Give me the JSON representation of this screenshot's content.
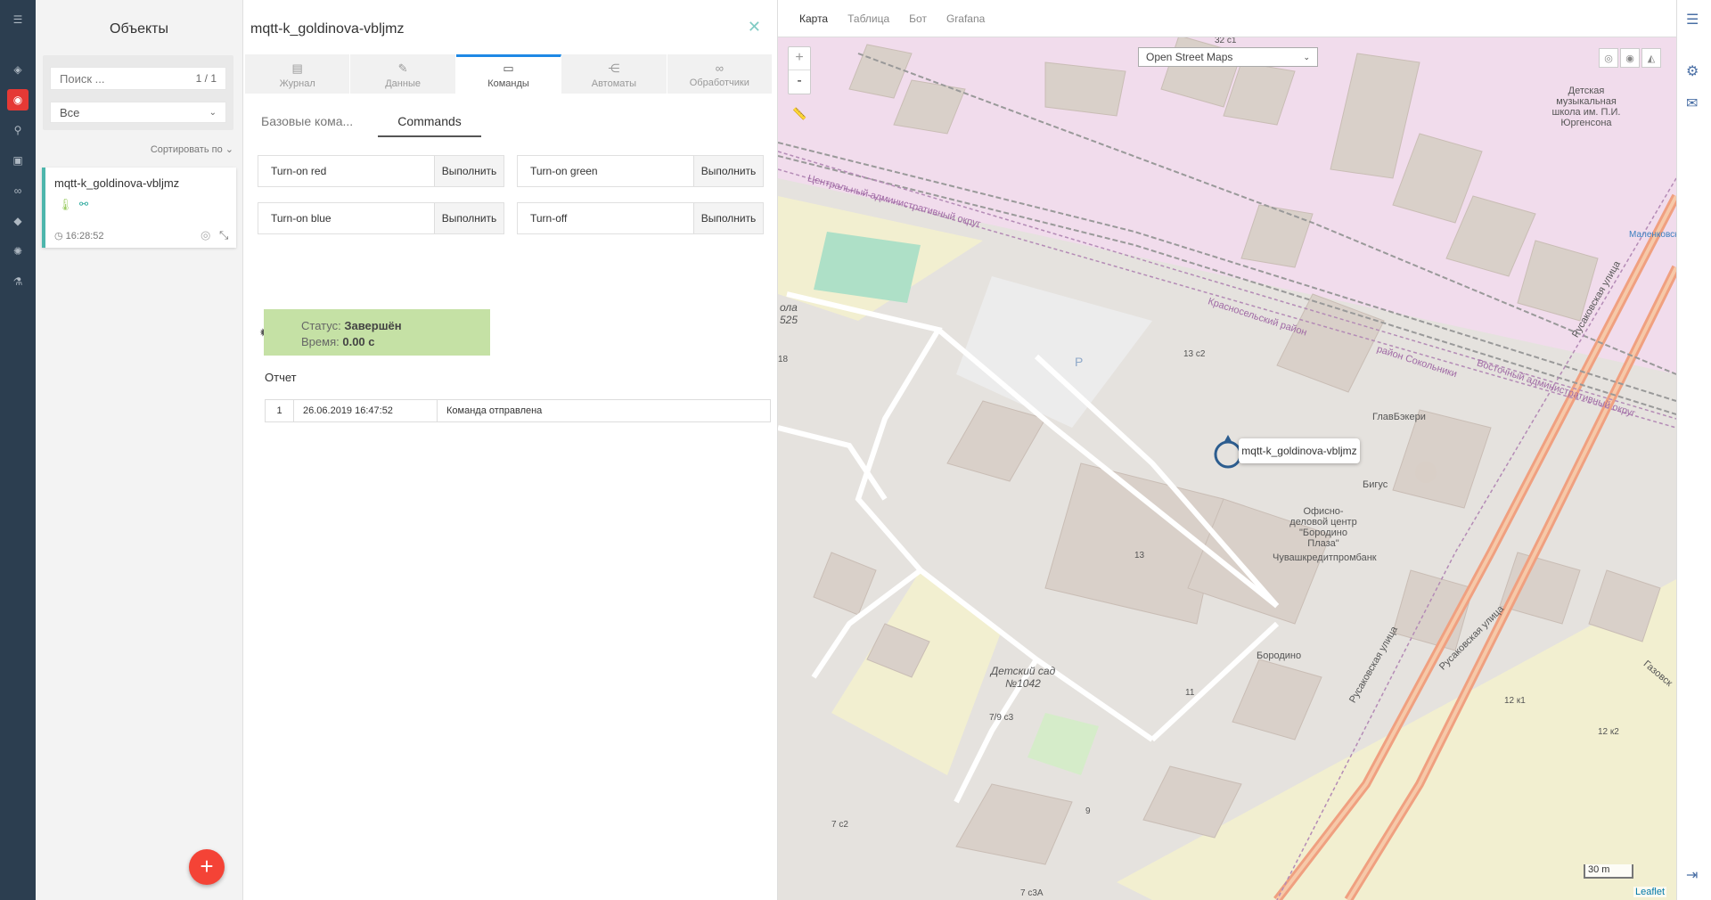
{
  "colors": {
    "accent_red": "#e53935",
    "accent_teal": "#4db6ac",
    "status_ok": "#c5e1a5",
    "sidebar_bg": "#2c3e50"
  },
  "rail_icons": [
    "menu-icon",
    "cube-icon",
    "objects-icon",
    "hierarchy-icon",
    "calendar-icon",
    "link-icon",
    "tag-icon",
    "globe-icon",
    "flask-icon"
  ],
  "objects": {
    "title": "Объекты",
    "search_placeholder": "Поиск ...",
    "search_count": "1 / 1",
    "filter_value": "Все",
    "sort_label": "Сортировать по",
    "items": [
      {
        "name": "mqtt-k_goldinova-vbljmz",
        "time": "16:28:52"
      }
    ]
  },
  "detail": {
    "title": "mqtt-k_goldinova-vbljmz",
    "tabs": [
      {
        "label": "Журнал"
      },
      {
        "label": "Данные"
      },
      {
        "label": "Команды"
      },
      {
        "label": "Автоматы"
      },
      {
        "label": "Обработчики"
      }
    ],
    "active_tab": "Команды",
    "subtabs": [
      {
        "label": "Базовые кома..."
      },
      {
        "label": "Commands"
      }
    ],
    "commands": [
      {
        "label": "Turn-on red",
        "button": "Выполнить"
      },
      {
        "label": "Turn-on green",
        "button": "Выполнить"
      },
      {
        "label": "Turn-on blue",
        "button": "Выполнить"
      },
      {
        "label": "Turn-off",
        "button": "Выполнить"
      }
    ],
    "status": {
      "status_label": "Статус:",
      "status_value": "Завершён",
      "time_label": "Время:",
      "time_value": "0.00 с"
    },
    "report_title": "Отчет",
    "report_rows": [
      {
        "n": "1",
        "datetime": "26.06.2019 16:47:52",
        "message": "Команда отправлена"
      }
    ]
  },
  "map": {
    "tabs": [
      "Карта",
      "Таблица",
      "Бот",
      "Grafana"
    ],
    "active_tab": "Карта",
    "zoom_in": "+",
    "zoom_out": "-",
    "layer": "Open Street Maps",
    "marker_label": "mqtt-k_goldinova-vbljmz",
    "scale": "30 m",
    "attribution": "Leaflet",
    "labels": {
      "school": "Детская музыкальная школа им. П.И. Юргенсона",
      "office": "Офисно-деловой центр \"Бородино Плаза\"",
      "bank": "Чувашкредитпромбанк",
      "glavbakery": "ГлавБэкери",
      "bigus": "Бигус",
      "borodino": "Бородино",
      "kindergarten": "Детский сад №1042",
      "street1": "Русаковская улица",
      "street2": "Русаковская улица",
      "street3": "Русаковская улица",
      "district1": "Красносельский район",
      "district2": "район Сокольники",
      "district3": "Восточный административный округ",
      "district4": "Центральный административный округ",
      "gazovskaya": "Газовск",
      "malenkovskaya": "Маленковская",
      "parking": "P",
      "b13c2": "13 с2",
      "b13": "13",
      "b11": "11",
      "b9": "9",
      "b79c3": "7/9 с3",
      "b7c2": "7 с2",
      "b12k1": "12 к1",
      "b12k2": "12 к2",
      "b32c1": "32 с1",
      "b7c3a": "7 с3А",
      "school525": "ола 525",
      "b18": "18"
    }
  }
}
